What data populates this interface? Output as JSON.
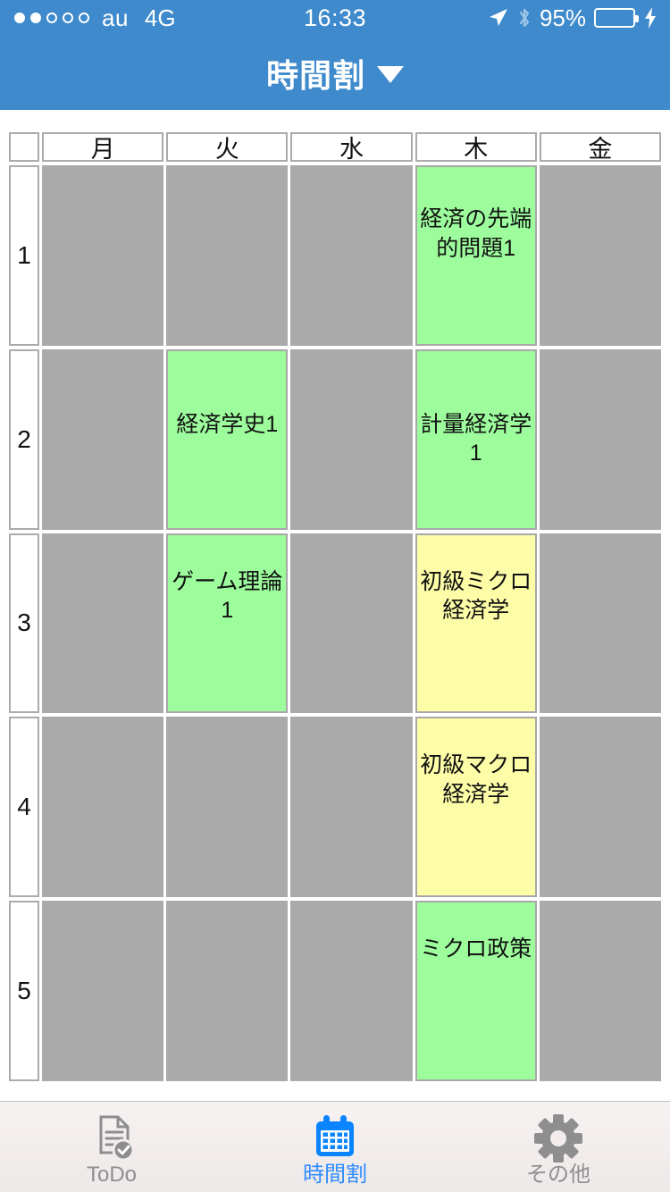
{
  "status_bar": {
    "signal_dots_filled": 2,
    "signal_dots_total": 5,
    "carrier": "au",
    "network": "4G",
    "time": "16:33",
    "battery_percent": "95%",
    "battery_level": 95,
    "location_icon": "location-arrow-icon",
    "bluetooth_icon": "bluetooth-icon",
    "charging_icon": "lightning-bolt-icon"
  },
  "navbar": {
    "title": "時間割",
    "caret": "▼"
  },
  "timetable": {
    "corner_label": "",
    "day_headers": [
      "月",
      "火",
      "水",
      "木",
      "金"
    ],
    "period_labels": [
      "1",
      "2",
      "3",
      "4",
      "5"
    ],
    "colors": {
      "empty": "#AAAAAA",
      "green": "#9DFD9D",
      "yellow": "#FDFDA8",
      "border": "#ABABAB",
      "accent": "#3E8ACC",
      "tab_active": "#2E8BFF"
    },
    "rows": [
      {
        "period": "1",
        "cells": [
          {
            "label": "",
            "color": "empty"
          },
          {
            "label": "",
            "color": "empty"
          },
          {
            "label": "",
            "color": "empty"
          },
          {
            "label": "経済の先端的問題1",
            "color": "green"
          },
          {
            "label": "",
            "color": "empty"
          }
        ]
      },
      {
        "period": "2",
        "cells": [
          {
            "label": "",
            "color": "empty"
          },
          {
            "label": "経済学史1",
            "color": "green"
          },
          {
            "label": "",
            "color": "empty"
          },
          {
            "label": "計量経済学1",
            "color": "green"
          },
          {
            "label": "",
            "color": "empty"
          }
        ]
      },
      {
        "period": "3",
        "cells": [
          {
            "label": "",
            "color": "empty"
          },
          {
            "label": "ゲーム理論1",
            "color": "green"
          },
          {
            "label": "",
            "color": "empty"
          },
          {
            "label": "初級ミクロ経済学",
            "color": "yellow"
          },
          {
            "label": "",
            "color": "empty"
          }
        ]
      },
      {
        "period": "4",
        "cells": [
          {
            "label": "",
            "color": "empty"
          },
          {
            "label": "",
            "color": "empty"
          },
          {
            "label": "",
            "color": "empty"
          },
          {
            "label": "初級マクロ経済学",
            "color": "yellow"
          },
          {
            "label": "",
            "color": "empty"
          }
        ]
      },
      {
        "period": "5",
        "cells": [
          {
            "label": "",
            "color": "empty"
          },
          {
            "label": "",
            "color": "empty"
          },
          {
            "label": "",
            "color": "empty"
          },
          {
            "label": "ミクロ政策",
            "color": "green"
          },
          {
            "label": "",
            "color": "empty"
          }
        ]
      }
    ]
  },
  "tabbar": {
    "tabs": [
      {
        "label": "ToDo",
        "icon": "document-check-icon",
        "active": false
      },
      {
        "label": "時間割",
        "icon": "calendar-icon",
        "active": true
      },
      {
        "label": "その他",
        "icon": "gear-icon",
        "active": false
      }
    ]
  }
}
